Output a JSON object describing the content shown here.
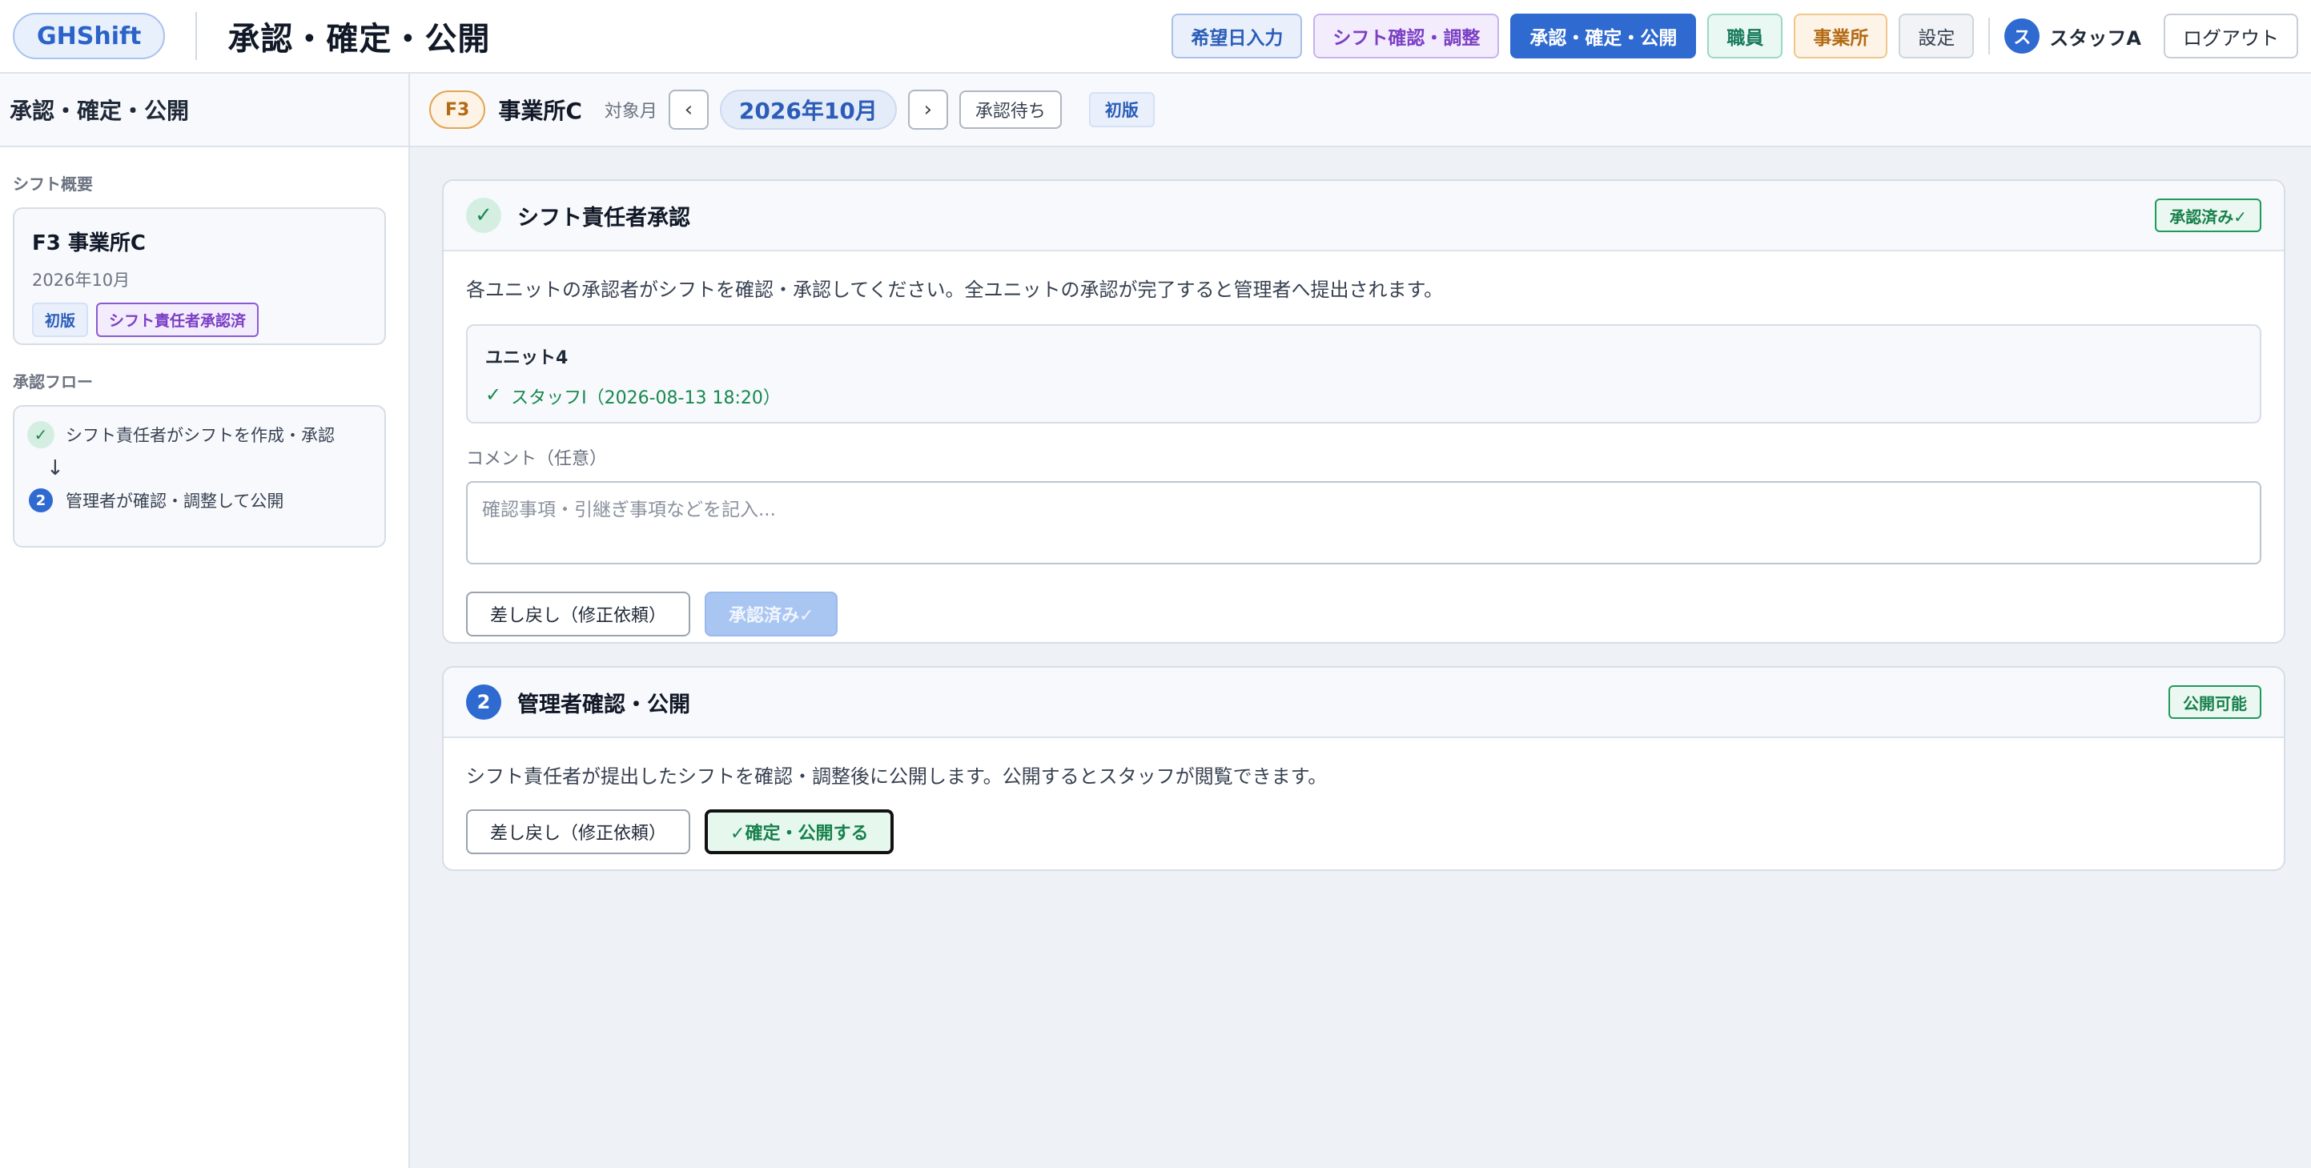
{
  "header": {
    "brand": "GHShift",
    "title": "承認・確定・公開",
    "nav": {
      "request": "希望日入力",
      "shift": "シフト確認・調整",
      "approve": "承認・確定・公開",
      "staff": "職員",
      "office": "事業所",
      "settings": "設定"
    },
    "user": {
      "initial": "ス",
      "name": "スタッフA"
    },
    "logout": "ログアウト"
  },
  "sidebar": {
    "title": "承認・確定・公開",
    "summary_label": "シフト概要",
    "summary": {
      "office": "F3 事業所C",
      "month": "2026年10月",
      "version_badge": "初版",
      "status_badge": "シフト責任者承認済"
    },
    "flow_label": "承認フロー",
    "flow": {
      "step1_mark": "✓",
      "step1": "シフト責任者がシフトを作成・承認",
      "arrow": "↓",
      "step2_mark": "2",
      "step2": "管理者が確認・調整して公開"
    }
  },
  "topbar": {
    "office_code": "F3",
    "office_name": "事業所C",
    "month_label": "対象月",
    "prev": "‹",
    "month": "2026年10月",
    "next": "›",
    "status": "承認待ち",
    "version": "初版"
  },
  "panel1": {
    "icon": "✓",
    "title": "シフト責任者承認",
    "status": "承認済み✓",
    "description": "各ユニットの承認者がシフトを確認・承認してください。全ユニットの承認が完了すると管理者へ提出されます。",
    "unit": {
      "name": "ユニット4",
      "check": "✓",
      "approval": "スタッフI（2026-08-13 18:20）"
    },
    "comment_label": "コメント（任意）",
    "comment_placeholder": "確認事項・引継ぎ事項などを記入...",
    "return_button": "差し戻し（修正依頼）",
    "approved_button": "承認済み✓"
  },
  "panel2": {
    "icon": "2",
    "title": "管理者確認・公開",
    "status": "公開可能",
    "description": "シフト責任者が提出したシフトを確認・調整後に公開します。公開するとスタッフが閲覧できます。",
    "return_button": "差し戻し（修正依頼）",
    "publish_button": "✓確定・公開する"
  }
}
